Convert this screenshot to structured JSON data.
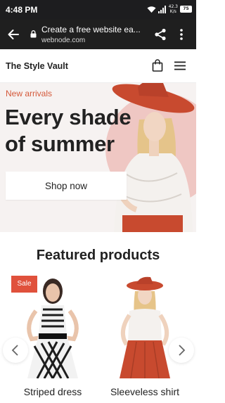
{
  "status_bar": {
    "time": "4:48 PM",
    "net_speed_value": "42.3",
    "net_speed_unit": "K/s",
    "battery": "75"
  },
  "browser": {
    "page_title": "Create a free website ea...",
    "domain": "webnode.com"
  },
  "site": {
    "title": "The Style Vault"
  },
  "hero": {
    "subtitle": "New arrivals",
    "heading_line1": "Every shade",
    "heading_line2": "of summer",
    "cta_label": "Shop now"
  },
  "featured": {
    "title": "Featured products",
    "products": [
      {
        "name": "Striped dress",
        "badge": "Sale"
      },
      {
        "name": "Sleeveless shirt",
        "badge": ""
      }
    ]
  },
  "colors": {
    "accent": "#d4593a",
    "sale_badge": "#e0513c",
    "hero_circle": "#efc7c3",
    "browser_bar": "#1f1f1f"
  },
  "icons": [
    "back-arrow-icon",
    "lock-icon",
    "share-icon",
    "more-vert-icon",
    "shopping-bag-icon",
    "hamburger-menu-icon",
    "chevron-left-icon",
    "chevron-right-icon",
    "wifi-icon",
    "signal-icon",
    "battery-icon"
  ]
}
